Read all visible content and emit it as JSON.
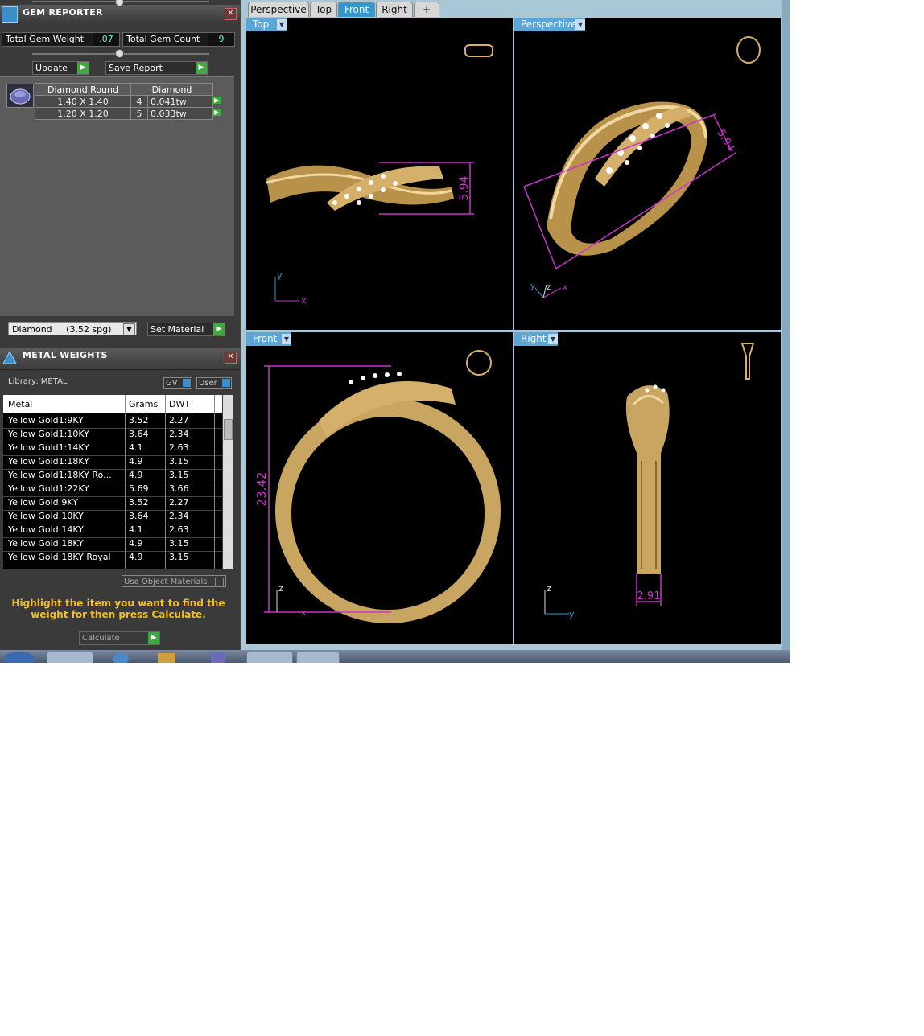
{
  "gem_reporter": {
    "title": "GEM REPORTER",
    "total_weight_label": "Total Gem Weight",
    "total_weight_value": ".07",
    "total_count_label": "Total Gem Count",
    "total_count_value": "9",
    "update_label": "Update",
    "save_report_label": "Save Report",
    "table": {
      "headers": [
        "Diamond Round",
        "Diamond"
      ],
      "rows": [
        {
          "size": "1.40 X 1.40",
          "count": "4",
          "weight": "0.041tw"
        },
        {
          "size": "1.20 X 1.20",
          "count": "5",
          "weight": "0.033tw"
        }
      ]
    },
    "material_select": "Diamond     (3.52 spg)",
    "set_material_label": "Set Material"
  },
  "metal_weights": {
    "title": "METAL WEIGHTS",
    "library_label": "Library: METAL",
    "gv_label": "GV",
    "user_label": "User",
    "columns": [
      "Metal",
      "Grams",
      "DWT"
    ],
    "rows": [
      {
        "metal": "Yellow Gold1:9KY",
        "grams": "3.52",
        "dwt": "2.27"
      },
      {
        "metal": "Yellow Gold1:10KY",
        "grams": "3.64",
        "dwt": "2.34"
      },
      {
        "metal": "Yellow Gold1:14KY",
        "grams": "4.1",
        "dwt": "2.63"
      },
      {
        "metal": "Yellow Gold1:18KY",
        "grams": "4.9",
        "dwt": "3.15"
      },
      {
        "metal": "Yellow Gold1:18KY Ro...",
        "grams": "4.9",
        "dwt": "3.15"
      },
      {
        "metal": "Yellow Gold1:22KY",
        "grams": "5.69",
        "dwt": "3.66"
      },
      {
        "metal": "Yellow Gold:9KY",
        "grams": "3.52",
        "dwt": "2.27"
      },
      {
        "metal": "Yellow Gold:10KY",
        "grams": "3.64",
        "dwt": "2.34"
      },
      {
        "metal": "Yellow Gold:14KY",
        "grams": "4.1",
        "dwt": "2.63"
      },
      {
        "metal": "Yellow Gold:18KY",
        "grams": "4.9",
        "dwt": "3.15"
      },
      {
        "metal": "Yellow Gold:18KY Royal",
        "grams": "4.9",
        "dwt": "3.15"
      }
    ],
    "use_object_materials_label": "Use Object Materials",
    "hint": "Highlight the item you want to find the weight for then press Calculate.",
    "calculate_label": "Calculate"
  },
  "viewport_tabs": [
    "Perspective",
    "Top",
    "Front",
    "Right",
    "+"
  ],
  "active_tab": "Front",
  "viewports": {
    "top": {
      "label": "Top",
      "dimension": "5.94",
      "axis_y": "y",
      "axis_x": "x"
    },
    "perspective": {
      "label": "Perspective",
      "dimension": "5.94",
      "axis_y": "y",
      "axis_z": "z",
      "axis_x": "x"
    },
    "front": {
      "label": "Front",
      "dimension": "23.42",
      "axis_z": "z",
      "axis_x": "x"
    },
    "right": {
      "label": "Right",
      "dimension": "2.91",
      "axis_z": "z",
      "axis_y": "y"
    }
  },
  "colors": {
    "gold": "#d4b06a",
    "dimension": "#cc33cc",
    "accent": "#3399cc"
  }
}
